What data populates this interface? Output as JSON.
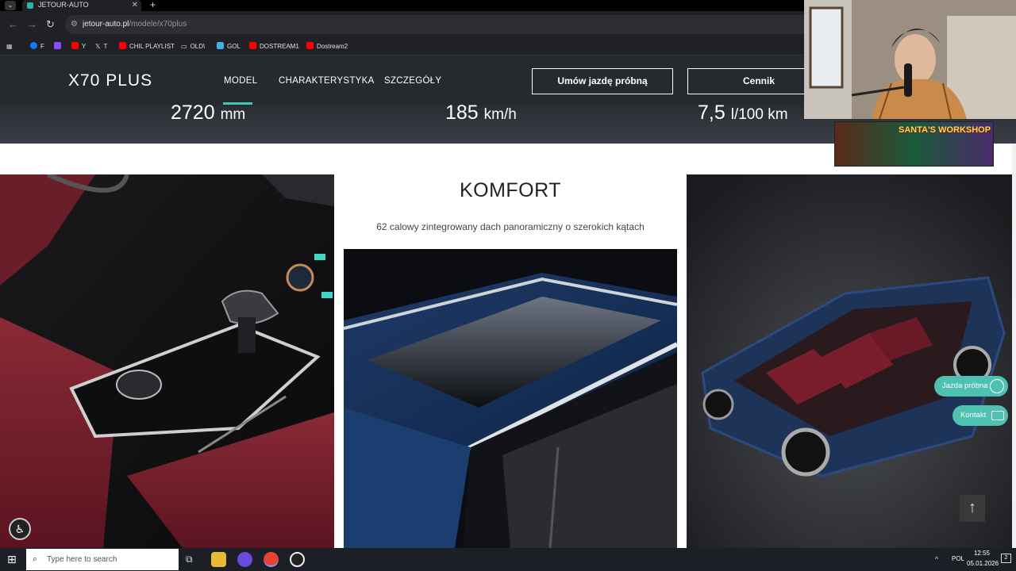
{
  "browser": {
    "tab_title": "JETOUR-AUTO",
    "url_host": "jetour-auto.pl",
    "url_path": "/modele/x70plus",
    "bookmarks": [
      {
        "label": "F",
        "icon": "facebook-icon",
        "color": "#1877f2"
      },
      {
        "label": "",
        "icon": "twitch-icon",
        "color": "#9146ff"
      },
      {
        "label": "Y",
        "icon": "youtube-icon",
        "color": "#ff0000"
      },
      {
        "label": "T",
        "icon": "x-icon",
        "color": "#e0e0e0"
      },
      {
        "label": "CHIL PLAYLIST",
        "icon": "youtube-icon",
        "color": "#ff0000"
      },
      {
        "label": "OLD\\",
        "icon": "folder-icon",
        "color": "#e0e0e0"
      },
      {
        "label": "GOL",
        "icon": "gol-icon",
        "color": "#3fb0e0"
      },
      {
        "label": "DOSTREAM1",
        "icon": "youtube-icon",
        "color": "#ff0000"
      },
      {
        "label": "Dostream2",
        "icon": "youtube-icon",
        "color": "#ff0000"
      }
    ]
  },
  "site": {
    "logo_main": "X70",
    "logo_suffix": "PLUS",
    "nav": [
      "MODEL",
      "CHARAKTERYSTYKA",
      "SZCZEGÓŁY"
    ],
    "test_drive_button": "Umów jazdę próbną",
    "pricing_button": "Cennik",
    "specs": [
      {
        "value": "2720",
        "unit": "mm"
      },
      {
        "value": "185",
        "unit": "km/h"
      },
      {
        "value": "7,5",
        "unit": "l/100 km"
      }
    ],
    "feature_title": "KOMFORT",
    "feature_desc": "62 calowy zintegrowany dach panoramiczny o szerokich kątach",
    "float_test_drive": "Jazda próbna",
    "float_contact": "Kontakt",
    "accent_color": "#3dc8b2"
  },
  "overlay": {
    "sticker_text": "SANTA'S WORKSHOP"
  },
  "taskbar": {
    "search_placeholder": "Type here to search",
    "language": "POL",
    "time": "12:55",
    "date": "05.01.2026",
    "notifications": "2"
  }
}
